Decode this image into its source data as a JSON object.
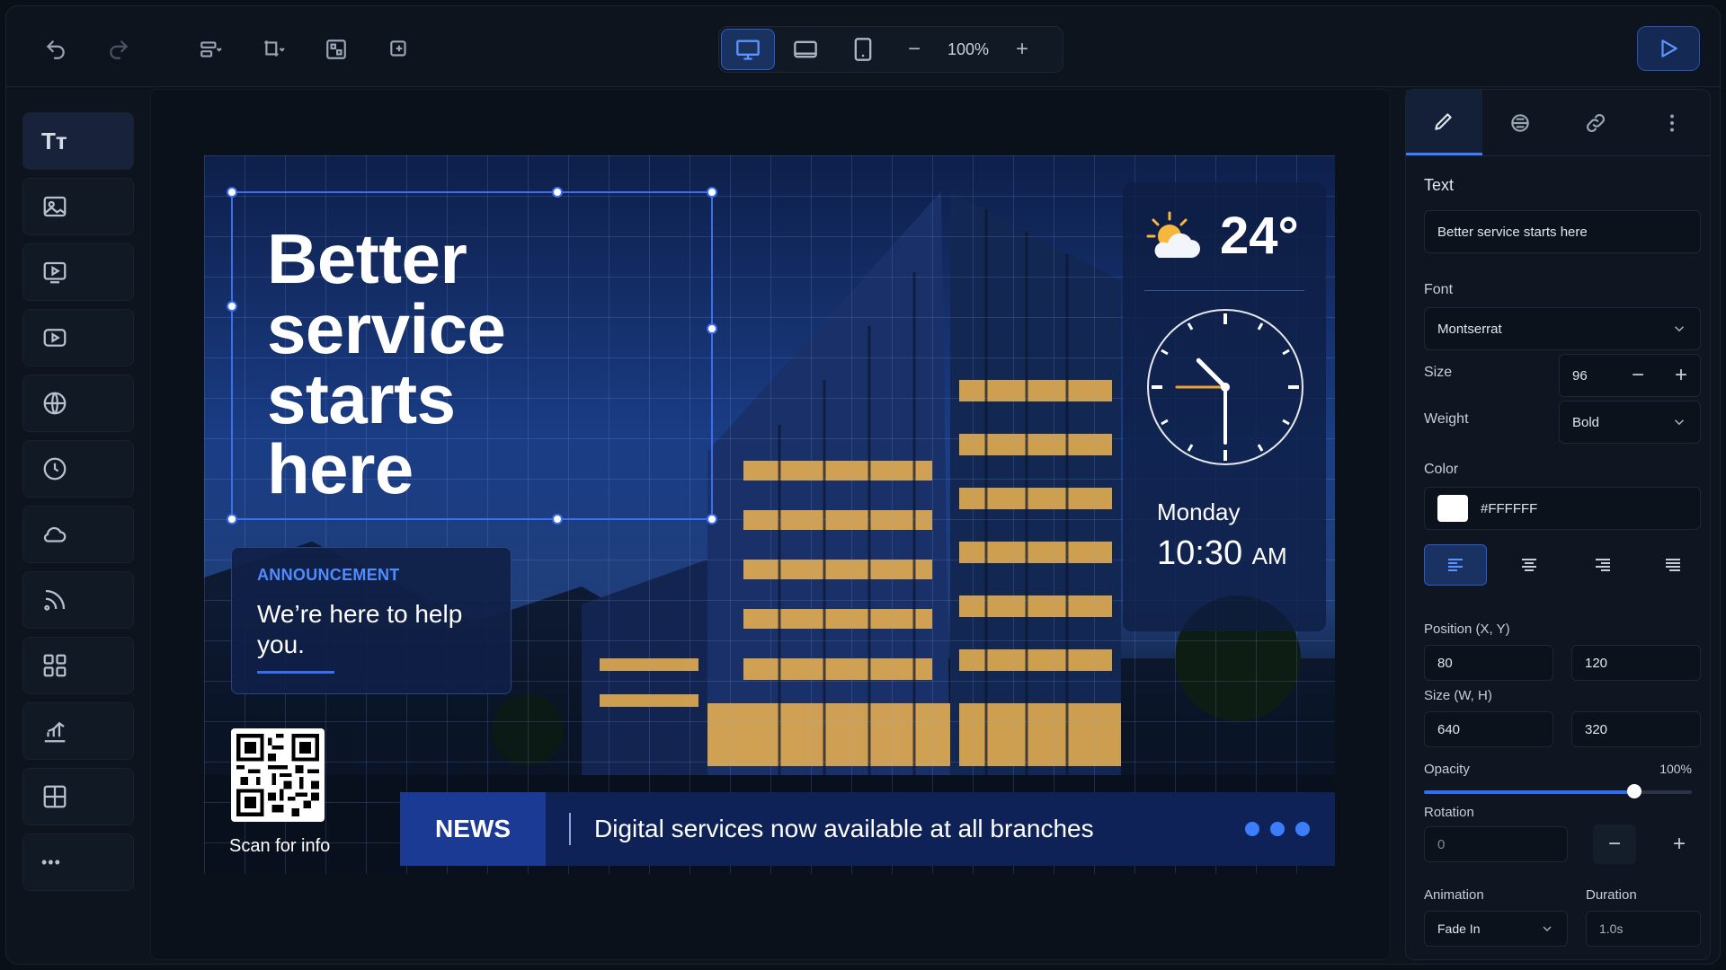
{
  "toolbar": {
    "undo_icon": "undo-icon",
    "redo_icon": "redo-icon",
    "zoom": "100%",
    "zoom_out": "−",
    "zoom_in": "+"
  },
  "rail": {
    "text_tool": "Tт",
    "more": "•••"
  },
  "signage": {
    "headline": [
      "Better",
      "service",
      "starts",
      "here"
    ],
    "announcement_label": "ANNOUNCEMENT",
    "announcement_text": "We’re here to help you.",
    "qr_caption": "Scan for info",
    "ticker_label": "NEWS",
    "ticker_text": "Digital services now available at all branches",
    "temperature": "24°",
    "day": "Monday",
    "time": "10:30",
    "ampm": "AM",
    "clock": {
      "hour": 10,
      "minute": 30
    }
  },
  "panel": {
    "section_title": "Text",
    "text_value": "Better service starts here",
    "font_label": "Font",
    "font_value": "Montserrat",
    "size_label": "Size",
    "size_value": "96",
    "weight_label": "Weight",
    "weight_value": "Bold",
    "color_label": "Color",
    "color_value": "#FFFFFF",
    "position_label": "Position (X, Y)",
    "position_x": "80",
    "position_y": "120",
    "dims_label": "Size (W, H)",
    "dims_w": "640",
    "dims_h": "320",
    "opacity_label": "Opacity",
    "opacity_value": "100%",
    "opacity_fraction": 1.0,
    "rotation_label": "Rotation",
    "rotation_value": "0",
    "animation_label": "Animation",
    "animation_value": "Fade In",
    "duration_label": "Duration",
    "duration_value": "1.0s",
    "minus": "−",
    "plus": "+"
  },
  "colors": {
    "accent": "#3b7dff",
    "background": "#0d141e",
    "ticker": "#0f2257"
  }
}
